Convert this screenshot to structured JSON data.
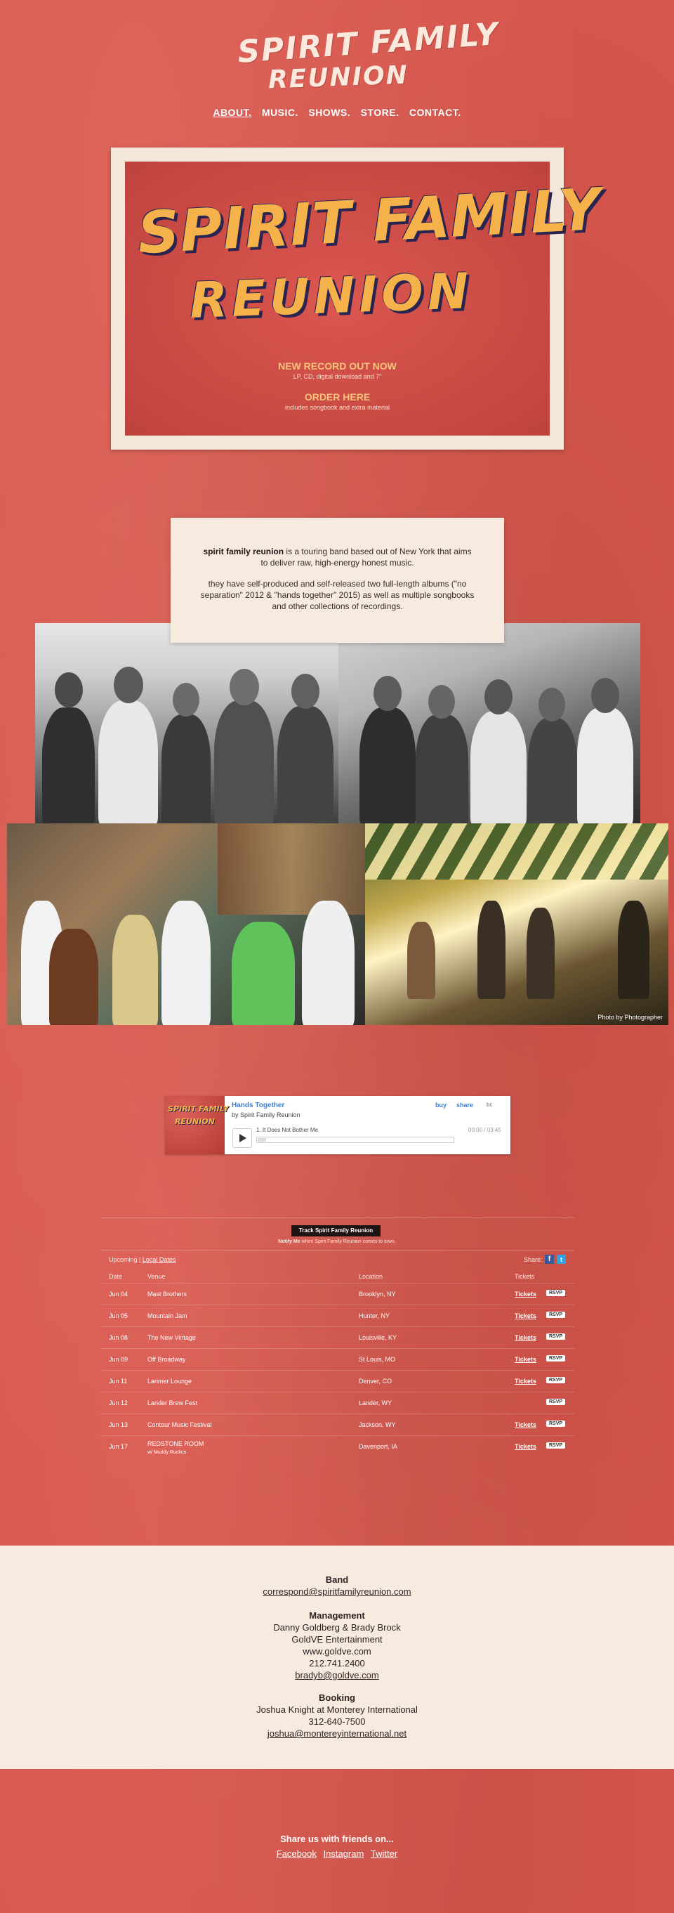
{
  "header": {
    "logo_line1": "SPIRIT FAMILY",
    "logo_line2": "REUNION"
  },
  "nav": {
    "items": [
      "ABOUT.",
      "MUSIC.",
      "SHOWS.",
      "STORE.",
      "CONTACT."
    ]
  },
  "hero": {
    "title_line1": "SPIRIT FAMILY",
    "title_line2": "REUNION",
    "cta1_title": "NEW RECORD OUT NOW",
    "cta1_sub": "LP, CD, digital download and 7\"",
    "cta2_title": "ORDER HERE",
    "cta2_sub": "includes songbook and extra material"
  },
  "about": {
    "band_name": "spirit family reunion",
    "line1_rest": " is a touring band based out of New York that aims to deliver raw, high-energy honest music.",
    "line2": "they have self-produced and self-released two full-length albums (\"no separation\" 2012 & \"hands together\" 2015) as well as multiple songbooks and other collections of recordings."
  },
  "photos": {
    "caption": "Photo by Photographer"
  },
  "player": {
    "art_line1": "SPIRIT FAMILY",
    "art_line2": "REUNION",
    "album": "Hands Together",
    "artist": "by Spirit Family Reunion",
    "buy": "buy",
    "share": "share",
    "bc": "bc",
    "track": "1.  It Does Not Bother Me",
    "time": "00:00 / 03:45"
  },
  "tour": {
    "track_button": "Track Spirit Family Reunion",
    "notify_bold": "Notify Me",
    "notify_rest": " when Spirit Family Reunion comes to town.",
    "tab_upcoming": "Upcoming",
    "tab_local": "Local Dates",
    "share_label": "Share:",
    "headers": {
      "date": "Date",
      "venue": "Venue",
      "location": "Location",
      "tickets": "Tickets"
    },
    "rows": [
      {
        "date": "Jun 04",
        "venue": "Mast Brothers",
        "sub": "",
        "location": "Brooklyn, NY",
        "tickets": "Tickets",
        "rsvp": "RSVP"
      },
      {
        "date": "Jun 05",
        "venue": "Mountain Jam",
        "sub": "",
        "location": "Hunter, NY",
        "tickets": "Tickets",
        "rsvp": "RSVP"
      },
      {
        "date": "Jun 08",
        "venue": "The New Vintage",
        "sub": "",
        "location": "Louisville, KY",
        "tickets": "Tickets",
        "rsvp": "RSVP"
      },
      {
        "date": "Jun 09",
        "venue": "Off Broadway",
        "sub": "",
        "location": "St Louis, MO",
        "tickets": "Tickets",
        "rsvp": "RSVP"
      },
      {
        "date": "Jun 11",
        "venue": "Larimer Lounge",
        "sub": "",
        "location": "Denver, CO",
        "tickets": "Tickets",
        "rsvp": "RSVP"
      },
      {
        "date": "Jun 12",
        "venue": "Lander Brew Fest",
        "sub": "",
        "location": "Lander, WY",
        "tickets": "",
        "rsvp": "RSVP"
      },
      {
        "date": "Jun 13",
        "venue": "Contour Music Festival",
        "sub": "",
        "location": "Jackson, WY",
        "tickets": "Tickets",
        "rsvp": "RSVP"
      },
      {
        "date": "Jun 17",
        "venue": "REDSTONE ROOM",
        "sub": "w/ Muddy Ruckus",
        "location": "Davenport, IA",
        "tickets": "Tickets",
        "rsvp": "RSVP"
      }
    ]
  },
  "contact": {
    "band_h": "Band",
    "band_email": "correspond@spiritfamilyreunion.com",
    "mgmt_h": "Management",
    "mgmt_names": "Danny Goldberg & Brady Brock",
    "mgmt_company": "GoldVE Entertainment",
    "mgmt_site": "www.goldve.com",
    "mgmt_phone": "212.741.2400",
    "mgmt_email": "bradyb@goldve.com",
    "booking_h": "Booking",
    "booking_name": "Joshua Knight at Monterey International",
    "booking_phone": "312-640-7500",
    "booking_email": "joshua@montereyinternational.net"
  },
  "footer": {
    "title": "Share us with friends on...",
    "links": [
      "Facebook",
      "Instagram",
      "Twitter"
    ]
  },
  "colors": {
    "background": "#d9574d",
    "cream": "#f7ebe0",
    "hero_letters": "#f6b24a",
    "letter_shadow": "#2a2550",
    "player_link": "#3c7fd6"
  }
}
